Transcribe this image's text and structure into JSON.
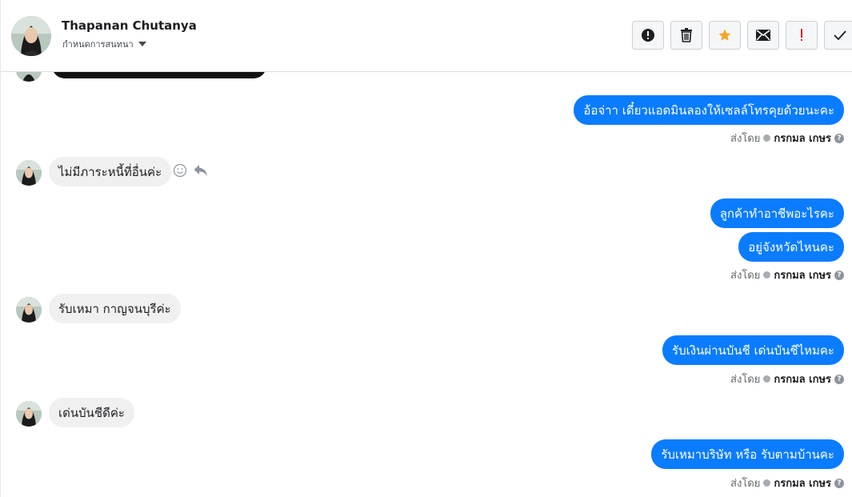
{
  "header": {
    "contact_name": "Thapanan Chutanya",
    "assign_label": "กำหนดการสนทนา",
    "actions": [
      {
        "icon": "alert-circle-icon"
      },
      {
        "icon": "trash-icon"
      },
      {
        "icon": "star-icon"
      },
      {
        "icon": "envelope-icon"
      },
      {
        "icon": "exclamation-icon"
      },
      {
        "icon": "check-icon"
      }
    ]
  },
  "messages": [
    {
      "dir": "out",
      "text": "อ้อจ่าา เดี๋ยวแอดมินลองให้เซลล์โทรคุยด้วยนะคะ"
    },
    {
      "dir": "meta",
      "sent_by_label": "ส่งโดย",
      "agent": "กรกมล เกษร"
    },
    {
      "dir": "in",
      "text": "ไม่มีภาระหนี้ที่อื่นค่ะ"
    },
    {
      "dir": "out",
      "text": "ลูกค้าทำอาชีพอะไรคะ"
    },
    {
      "dir": "out",
      "text": "อยู่จังหวัดไหนคะ"
    },
    {
      "dir": "meta",
      "sent_by_label": "ส่งโดย",
      "agent": "กรกมล เกษร"
    },
    {
      "dir": "in",
      "text": "รับเหมา กาญจนบุรีค่ะ"
    },
    {
      "dir": "out",
      "text": "รับเงินผ่านบันชี เด่นบันชีไหมคะ"
    },
    {
      "dir": "meta",
      "sent_by_label": "ส่งโดย",
      "agent": "กรกมล เกษร"
    },
    {
      "dir": "in",
      "text": "เด่นบันชีดีค่ะ"
    },
    {
      "dir": "out",
      "text": "รับเหมาบริษัท หรือ รับตามบ้านคะ"
    },
    {
      "dir": "meta",
      "sent_by_label": "ส่งโดย",
      "agent": "กรกมล เกษร"
    }
  ],
  "colors": {
    "outgoing_bubble": "#0a7cff",
    "incoming_bubble": "#f0f0f0",
    "star": "#f5a623",
    "exclamation": "#e02020"
  }
}
